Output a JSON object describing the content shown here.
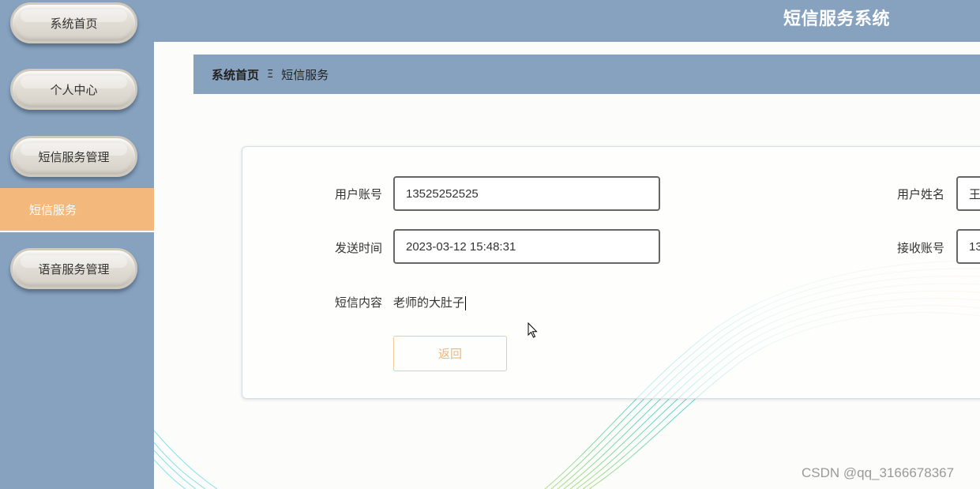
{
  "sidebar": {
    "items": [
      {
        "label": "系统首页"
      },
      {
        "label": "个人中心"
      },
      {
        "label": "短信服务管理"
      },
      {
        "label": "短信服务"
      },
      {
        "label": "语音服务管理"
      }
    ]
  },
  "header": {
    "title": "短信服务系统"
  },
  "breadcrumb": {
    "home": "系统首页",
    "separator": "Ξ",
    "current": "短信服务"
  },
  "form": {
    "account_label": "用户账号",
    "account_value": "13525252525",
    "name_label": "用户姓名",
    "name_value": "王",
    "send_time_label": "发送时间",
    "send_time_value": "2023-03-12 15:48:31",
    "receiver_label": "接收账号",
    "receiver_value": "13",
    "content_label": "短信内容",
    "content_value": "老师的大肚子",
    "back_button": "返回"
  },
  "watermark": "CSDN @qq_3166678367",
  "colors": {
    "sidebar_bg": "#86a2bf",
    "active_item": "#f3b87c",
    "button_text": "#f0b67b"
  }
}
